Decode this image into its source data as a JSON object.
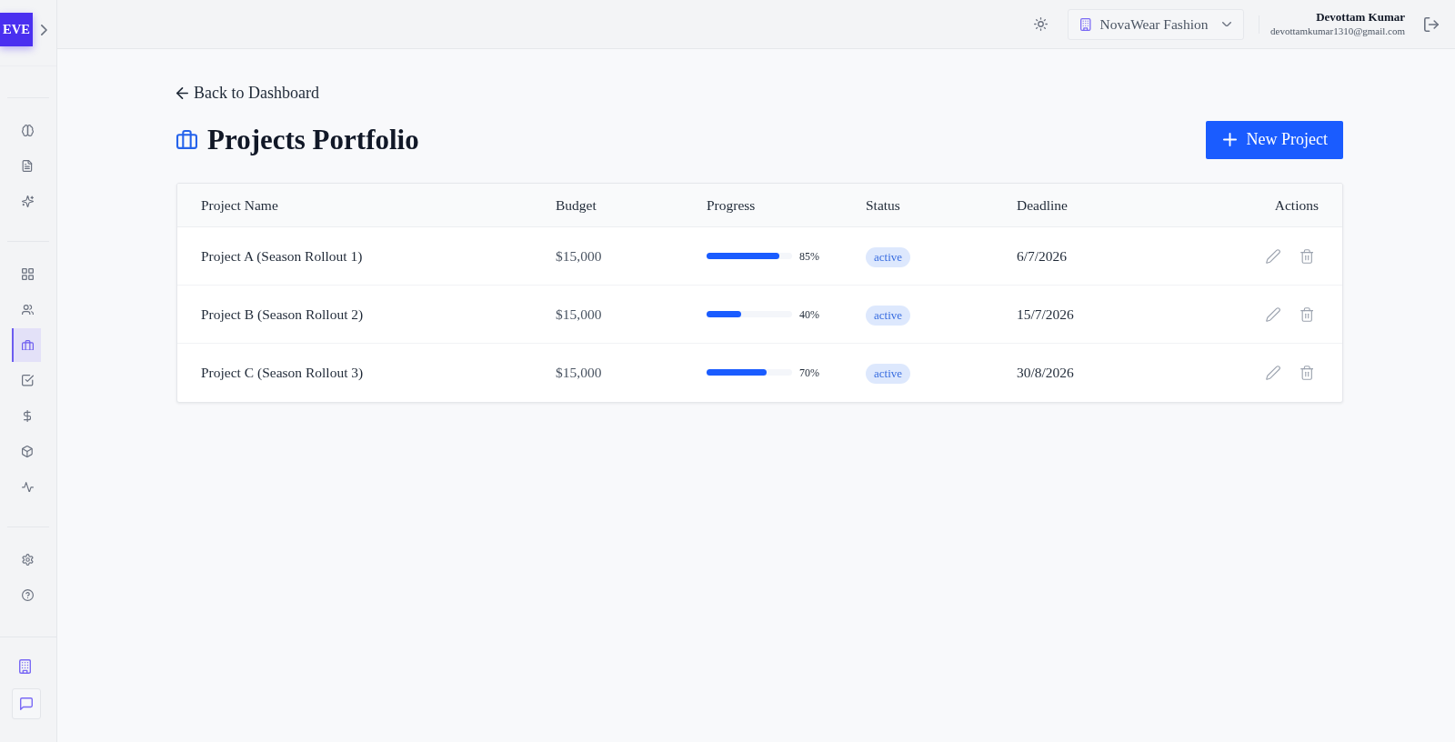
{
  "sidebar": {
    "logo": "EVE",
    "groups": [
      {
        "items": [
          {
            "selected": false
          },
          {
            "selected": false
          },
          {
            "selected": false
          }
        ]
      },
      {
        "items": [
          {
            "selected": false
          },
          {
            "selected": false
          },
          {
            "selected": true
          },
          {
            "selected": false
          },
          {
            "selected": false
          },
          {
            "selected": false
          },
          {
            "selected": false
          }
        ]
      },
      {
        "items": [
          {
            "selected": false
          },
          {
            "selected": false
          }
        ]
      }
    ]
  },
  "topbar": {
    "organization": "NovaWear Fashion",
    "user": {
      "name": "Devottam Kumar",
      "email": "devottamkumar1310@gmail.com"
    }
  },
  "page": {
    "back_link": "Back to Dashboard",
    "title": "Projects Portfolio",
    "new_button": "New Project"
  },
  "table": {
    "columns": [
      "Project Name",
      "Budget",
      "Progress",
      "Status",
      "Deadline",
      "Actions"
    ],
    "rows": [
      {
        "name": "Project A (Season Rollout 1)",
        "budget": "$15,000",
        "progress": {
          "level": 0.85,
          "reading": "85%"
        },
        "status": "active",
        "deadline": "6/7/2026"
      },
      {
        "name": "Project B (Season Rollout 2)",
        "budget": "$15,000",
        "progress": {
          "level": 0.4,
          "reading": "40%"
        },
        "status": "active",
        "deadline": "15/7/2026"
      },
      {
        "name": "Project C (Season Rollout 3)",
        "budget": "$15,000",
        "progress": {
          "level": 0.7,
          "reading": "70%"
        },
        "status": "active",
        "deadline": "30/8/2026"
      }
    ]
  }
}
